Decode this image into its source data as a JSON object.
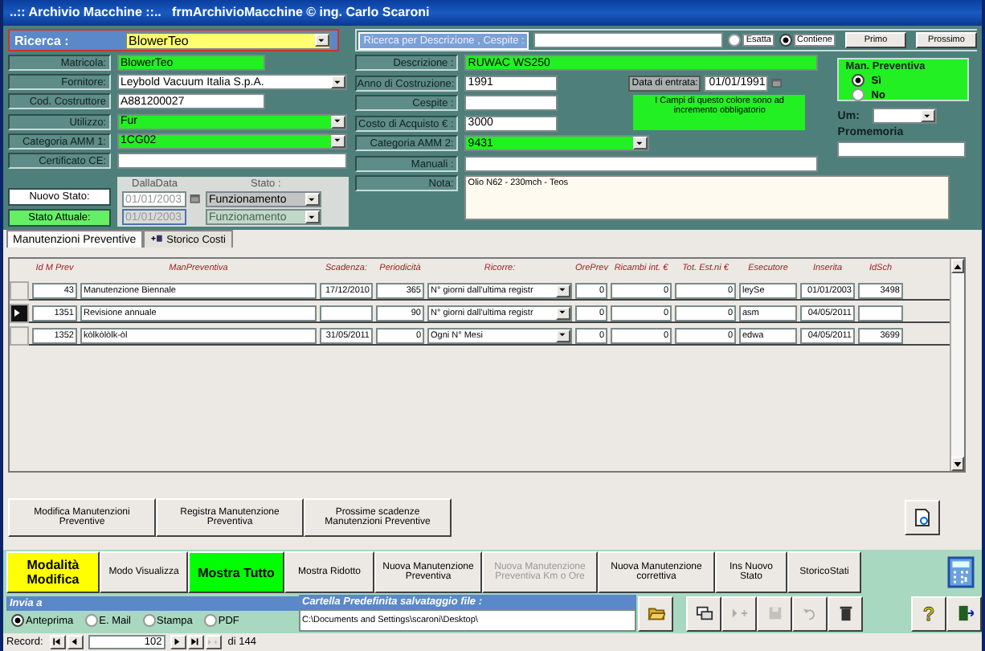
{
  "window": {
    "title": "..:: Archivio Macchine ::..   frmArchivioMacchine © ing. Carlo Scaroni"
  },
  "search": {
    "label": "Ricerca :",
    "value": "BlowerTeo"
  },
  "left_fields": [
    {
      "label": "Matricola:",
      "value": "BlowerTeo",
      "kind": "text",
      "required": true
    },
    {
      "label": "Fornitore:",
      "value": "Leybold Vacuum Italia S.p.A.",
      "kind": "combo",
      "required": false
    },
    {
      "label": "Cod. Costruttore",
      "value": "A881200027",
      "kind": "text",
      "required": false
    },
    {
      "label": "Utilizzo:",
      "value": "Fur",
      "kind": "combo",
      "required": true
    },
    {
      "label": "Categoria AMM 1:",
      "value": "1CG02",
      "kind": "combo",
      "required": true
    },
    {
      "label": "Certificato CE:",
      "kind": "text",
      "required": false
    }
  ],
  "status": {
    "new_label": "Nuovo Stato:",
    "current_label": "Stato Attuale:",
    "date_heading": "DallaData",
    "state_heading": "Stato :",
    "rows": [
      {
        "date": "01/01/2003",
        "state": "Funzionamento",
        "disabled": false
      },
      {
        "date": "01/01/2003",
        "state": "Funzionamento",
        "disabled": true
      }
    ]
  },
  "description_search": {
    "label": "Ricerca per Descrizione , Cespite :",
    "options": [
      {
        "label": "Esatta",
        "selected": false
      },
      {
        "label": "Contiene",
        "selected": true
      }
    ],
    "buttons": [
      "Primo",
      "Prossimo"
    ]
  },
  "mid_fields": [
    {
      "label": "Descrizione :",
      "value": "RUWAC WS250",
      "kind": "text",
      "required": true
    },
    {
      "label": "Anno di Costruzione:",
      "value": "1991",
      "kind": "text",
      "required": false
    },
    {
      "label": "Cespite :",
      "kind": "text",
      "required": false
    },
    {
      "label": "Costo di Acquisto € :",
      "value": "3000",
      "kind": "text",
      "required": false
    },
    {
      "label": "Categoria AMM 2:",
      "value": "9431",
      "kind": "combo",
      "required": true
    },
    {
      "label": "Manuali :",
      "kind": "text",
      "required": false
    }
  ],
  "entry_date": {
    "label": "Data di entrata:",
    "value": "01/01/1991"
  },
  "required_note": "I Campi di questo colore sono ad incremento obbligatorio",
  "preventive": {
    "title": "Man. Preventiva",
    "options": [
      {
        "label": "Sì",
        "selected": true
      },
      {
        "label": "No",
        "selected": false
      }
    ]
  },
  "um": {
    "label": "Um:"
  },
  "reminder": {
    "label": "Promemoria"
  },
  "note": {
    "label": "Nota:",
    "value": "Olio N62 - 230mch - Teos"
  },
  "tabs": [
    {
      "label": "Manutenzioni Preventive",
      "selected": true,
      "icon": false
    },
    {
      "label": "Storico Costi",
      "selected": false,
      "icon": true
    }
  ],
  "table": {
    "columns": [
      "Id M Prev",
      "ManPreventiva",
      "Scadenza:",
      "Periodicità",
      "Ricorre:",
      "OrePrev",
      "Ricambi int. €",
      "Tot. Est.ni €",
      "Esecutore",
      "Inserita",
      "IdSch"
    ],
    "rows": [
      {
        "current": false,
        "cells": [
          "43",
          "Manutenzione Biennale",
          "17/12/2010",
          "365",
          "N° giorni dall'ultima registr",
          "0",
          "0",
          "0",
          "leySe",
          "01/01/2003",
          "3498"
        ]
      },
      {
        "current": true,
        "cells": [
          "1351",
          "Revisione annuale",
          "",
          "90",
          "N° giorni dall'ultima registr",
          "0",
          "0",
          "0",
          "asm",
          "04/05/2011",
          ""
        ]
      },
      {
        "current": false,
        "cells": [
          "1352",
          "kòlkòlòlk-òl",
          "31/05/2011",
          "0",
          "Ogni  N° Mesi",
          "0",
          "0",
          "0",
          "edwa",
          "04/05/2011",
          "3699"
        ]
      }
    ]
  },
  "panel_buttons": [
    "Modifica Manutenzioni Preventive",
    "Registra Manutenzione Preventiva",
    "Prossime scadenze Manutenzioni Preventive"
  ],
  "toolbar": [
    {
      "label": "Modalità Modifica",
      "color": "#ffff00",
      "disabled": false
    },
    {
      "label": "Modo Visualizza",
      "disabled": false
    },
    {
      "label": "Mostra Tutto",
      "color": "#00ff00",
      "disabled": false
    },
    {
      "label": "Mostra Ridotto",
      "disabled": false
    },
    {
      "label": "Nuova Manutenzione Preventiva",
      "disabled": false
    },
    {
      "label": "Nuova Manutenzione Preventiva Km o Ore",
      "disabled": true
    },
    {
      "label": "Nuova Manutenzione correttiva",
      "disabled": false
    },
    {
      "label": "Ins Nuovo Stato",
      "disabled": false
    },
    {
      "label": "StoricoStati",
      "disabled": false
    }
  ],
  "send": {
    "title": "Invia a",
    "options": [
      {
        "label": "Anteprima",
        "selected": true
      },
      {
        "label": "E. Mail",
        "selected": false
      },
      {
        "label": "Stampa",
        "selected": false
      },
      {
        "label": "PDF",
        "selected": false
      }
    ]
  },
  "folder": {
    "title": "Cartella Predefinita salvataggio file :",
    "path": "C:\\Documents and Settings\\scaroni\\Desktop\\"
  },
  "actions": [
    {
      "kind": "window",
      "disabled": false
    },
    {
      "kind": "new",
      "disabled": true
    },
    {
      "kind": "save",
      "disabled": true
    },
    {
      "kind": "undo",
      "disabled": true
    },
    {
      "kind": "trash",
      "disabled": false
    }
  ],
  "help_label": "?",
  "record_nav": {
    "label": "Record:",
    "current": "102",
    "total": "di 144",
    "new_disabled": true
  }
}
